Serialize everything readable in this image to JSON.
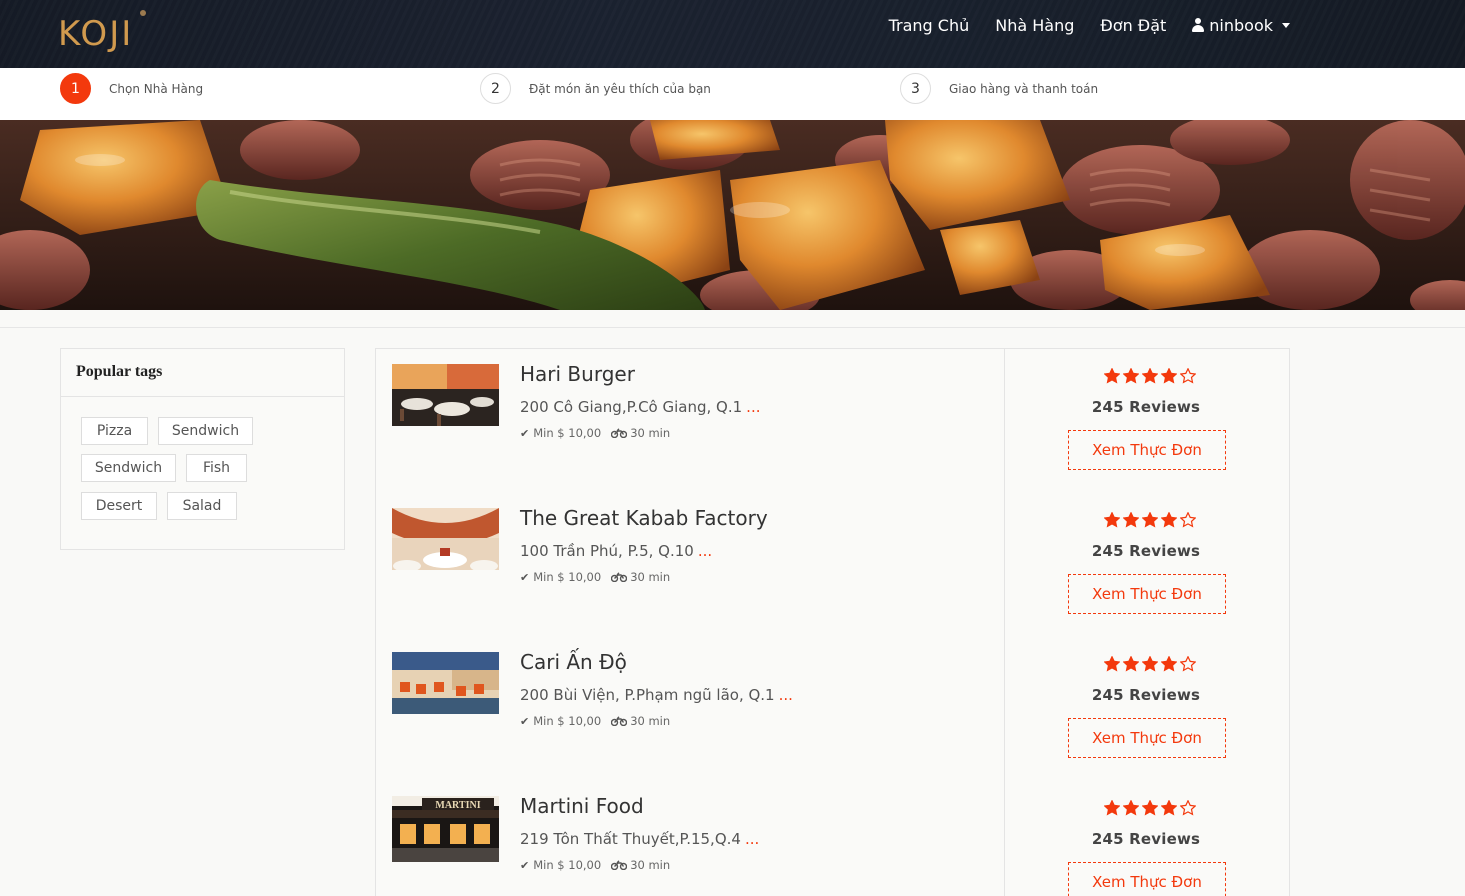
{
  "brand": {
    "logo_text": "KOJI"
  },
  "nav": {
    "home": "Trang Chủ",
    "restaurants": "Nhà Hàng",
    "orders": "Đơn Đặt",
    "user": "ninbook"
  },
  "steps": [
    {
      "num": "1",
      "label": "Chọn Nhà Hàng",
      "active": true
    },
    {
      "num": "2",
      "label": "Đặt món ăn yêu thích của bạn",
      "active": false
    },
    {
      "num": "3",
      "label": "Giao hàng và thanh toán",
      "active": false
    }
  ],
  "sidebar": {
    "title": "Popular tags",
    "tags": [
      "Pizza",
      "Sendwich",
      "Sendwich",
      "Fish",
      "Desert",
      "Salad"
    ]
  },
  "restaurants": [
    {
      "name": "Hari Burger",
      "address": "200 Cô Giang,P.Cô Giang, Q.1",
      "more": "...",
      "min": "Min $ 10,00",
      "time": "30 min",
      "rating": 4,
      "reviews": "245 Reviews",
      "button": "Xem Thực Đơn"
    },
    {
      "name": "The Great Kabab Factory",
      "address": "100 Trần Phú, P.5, Q.10",
      "more": "...",
      "min": "Min $ 10,00",
      "time": "30 min",
      "rating": 4,
      "reviews": "245 Reviews",
      "button": "Xem Thực Đơn"
    },
    {
      "name": "Cari Ấn Độ",
      "address": "200 Bùi Viện, P.Phạm ngũ lão, Q.1",
      "more": "...",
      "min": "Min $ 10,00",
      "time": "30 min",
      "rating": 4,
      "reviews": "245 Reviews",
      "button": "Xem Thực Đơn"
    },
    {
      "name": "Martini Food",
      "address": "219 Tôn Thất Thuyết,P.15,Q.4",
      "more": "...",
      "min": "Min $ 10,00",
      "time": "30 min",
      "rating": 4,
      "reviews": "245 Reviews",
      "button": "Xem Thực Đơn",
      "thumb_sign": "MARTINI"
    }
  ],
  "colors": {
    "accent": "#f3390d",
    "navbar": "#18202c",
    "logo": "#d19a4e"
  }
}
